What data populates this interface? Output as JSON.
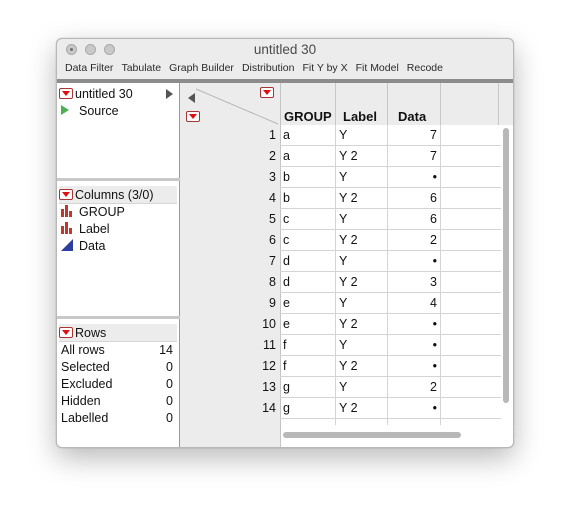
{
  "window": {
    "title": "untitled 30"
  },
  "menu": [
    "Data Filter",
    "Tabulate",
    "Graph Builder",
    "Distribution",
    "Fit Y by X",
    "Fit Model",
    "Recode"
  ],
  "table_panel": {
    "name": "untitled 30",
    "items": [
      {
        "label": "Source",
        "icon": "play-icon"
      }
    ]
  },
  "columns_panel": {
    "header": "Columns (3/0)",
    "items": [
      {
        "label": "GROUP",
        "icon": "nominal-bar-icon"
      },
      {
        "label": "Label",
        "icon": "nominal-bar-icon"
      },
      {
        "label": "Data",
        "icon": "continuous-triangle-icon"
      }
    ]
  },
  "rows_panel": {
    "header": "Rows",
    "stats": [
      {
        "label": "All rows",
        "value": "14"
      },
      {
        "label": "Selected",
        "value": "0"
      },
      {
        "label": "Excluded",
        "value": "0"
      },
      {
        "label": "Hidden",
        "value": "0"
      },
      {
        "label": "Labelled",
        "value": "0"
      }
    ]
  },
  "grid": {
    "headers": [
      "GROUP",
      "Label",
      "Data"
    ],
    "rows": [
      [
        "1",
        "a",
        "Y",
        "7"
      ],
      [
        "2",
        "a",
        "Y 2",
        "7"
      ],
      [
        "3",
        "b",
        "Y",
        "•"
      ],
      [
        "4",
        "b",
        "Y 2",
        "6"
      ],
      [
        "5",
        "c",
        "Y",
        "6"
      ],
      [
        "6",
        "c",
        "Y 2",
        "2"
      ],
      [
        "7",
        "d",
        "Y",
        "•"
      ],
      [
        "8",
        "d",
        "Y 2",
        "3"
      ],
      [
        "9",
        "e",
        "Y",
        "4"
      ],
      [
        "10",
        "e",
        "Y 2",
        "•"
      ],
      [
        "11",
        "f",
        "Y",
        "•"
      ],
      [
        "12",
        "f",
        "Y 2",
        "•"
      ],
      [
        "13",
        "g",
        "Y",
        "2"
      ],
      [
        "14",
        "g",
        "Y 2",
        "•"
      ]
    ]
  },
  "colors": {
    "accent_red": "#d11111",
    "source_green": "#4caf50",
    "nominal_red": "#c0392b",
    "continuous_blue": "#2c3e9e"
  }
}
